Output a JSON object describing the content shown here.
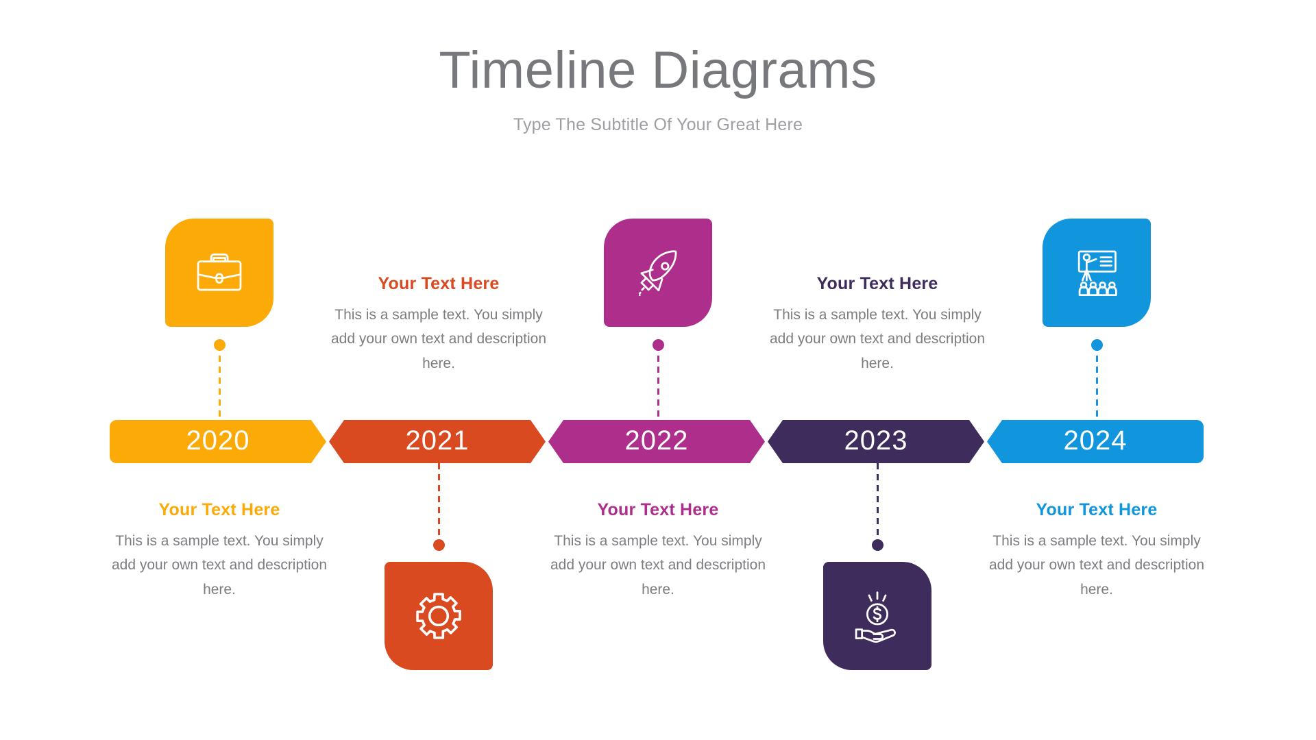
{
  "header": {
    "title": "Timeline Diagrams",
    "subtitle": "Type The Subtitle Of Your Great Here",
    "title_color": "#76787b",
    "subtitle_color": "#9d9fa2"
  },
  "body_text": "This is a sample text. You simply add your own text and description here.",
  "heading_text": "Your Text Here",
  "steps": [
    {
      "year": "2020",
      "color": "#fbaa07",
      "icon": "briefcase-icon",
      "icon_position": "top",
      "text_position": "bottom",
      "heading": "Your Text Here",
      "body": "This is a sample text. You simply add your own text and description here."
    },
    {
      "year": "2021",
      "color": "#d94a21",
      "icon": "gear-icon",
      "icon_position": "bottom",
      "text_position": "top",
      "heading": "Your Text Here",
      "body": "This is a sample text. You simply add your own text and description here."
    },
    {
      "year": "2022",
      "color": "#ae2e8c",
      "icon": "rocket-icon",
      "icon_position": "top",
      "text_position": "bottom",
      "heading": "Your Text Here",
      "body": "This is a sample text. You simply add your own text and description here."
    },
    {
      "year": "2023",
      "color": "#3d2c5c",
      "icon": "money-in-hand-icon",
      "icon_position": "bottom",
      "text_position": "top",
      "heading": "Your Text Here",
      "body": "This is a sample text. You simply add your own text and description here."
    },
    {
      "year": "2024",
      "color": "#1195dc",
      "icon": "presentation-training-icon",
      "icon_position": "top",
      "text_position": "bottom",
      "heading": "Your Text Here",
      "body": "This is a sample text. You simply add your own text and description here."
    }
  ]
}
